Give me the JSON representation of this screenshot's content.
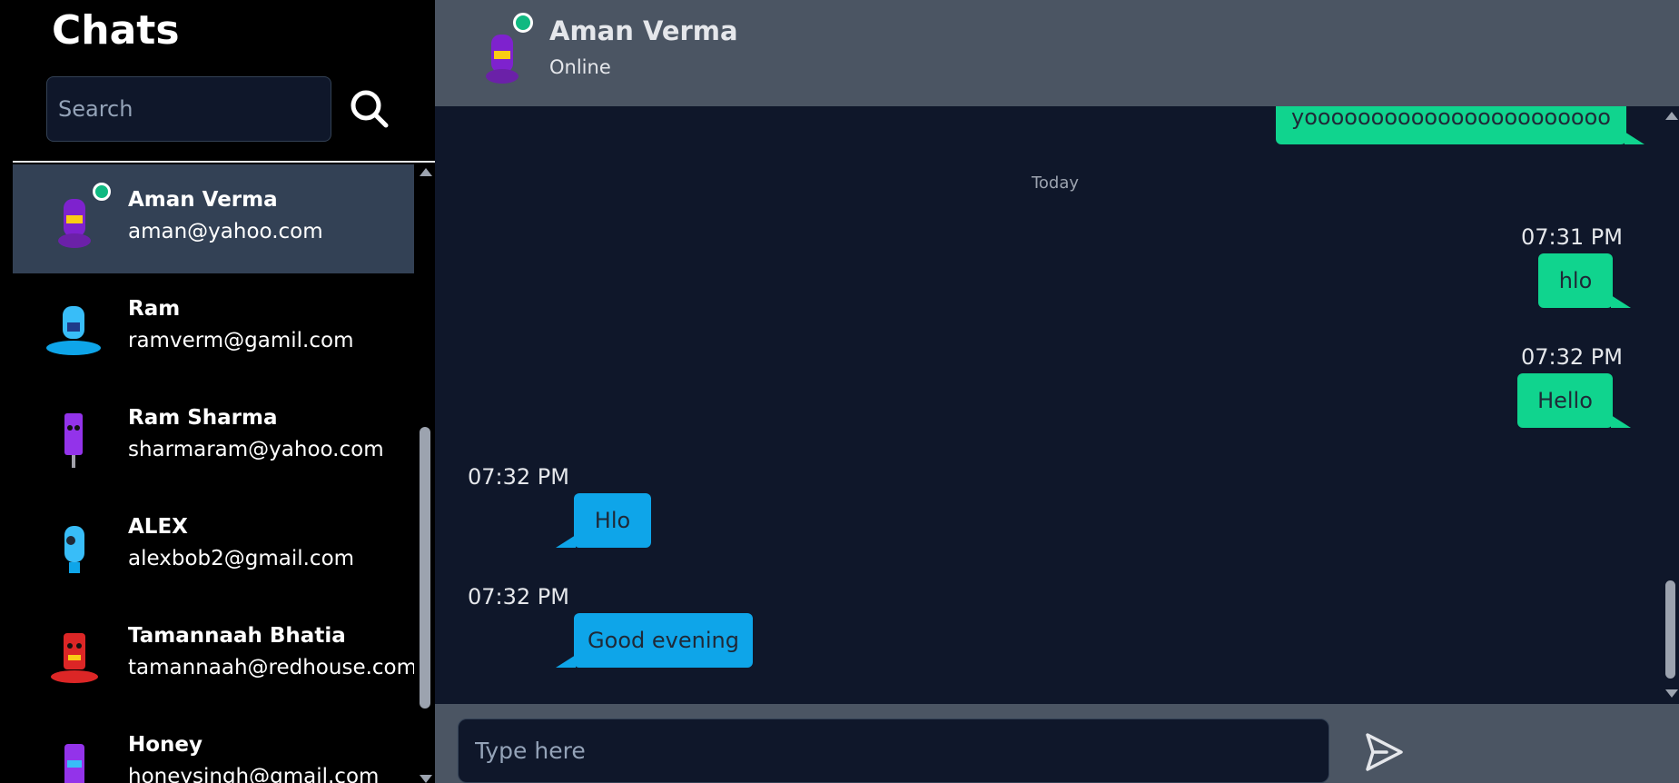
{
  "sidebar": {
    "title": "Chats",
    "search_placeholder": "Search",
    "contacts": [
      {
        "name": "Aman Verma",
        "email": "aman@yahoo.com",
        "online": true,
        "active": true,
        "avatar_color": "#7e22ce"
      },
      {
        "name": "Ram",
        "email": "ramverm@gamil.com",
        "online": false,
        "active": false,
        "avatar_color": "#38bdf8"
      },
      {
        "name": "Ram Sharma",
        "email": "sharmaram@yahoo.com",
        "online": false,
        "active": false,
        "avatar_color": "#9333ea"
      },
      {
        "name": "ALEX",
        "email": "alexbob2@gmail.com",
        "online": false,
        "active": false,
        "avatar_color": "#38bdf8"
      },
      {
        "name": "Tamannaah Bhatia",
        "email": "tamannaah@redhouse.com",
        "online": false,
        "active": false,
        "avatar_color": "#dc2626"
      },
      {
        "name": "Honey",
        "email": "honeysingh@gmail.com",
        "online": false,
        "active": false,
        "avatar_color": "#9333ea"
      }
    ]
  },
  "chat": {
    "title": "Aman Verma",
    "status": "Online",
    "date_separator": "Today",
    "messages": [
      {
        "direction": "sent",
        "text": "yooooooooooooooooooooooo",
        "time": ""
      },
      {
        "direction": "sent",
        "text": "hlo",
        "time": "07:31 PM"
      },
      {
        "direction": "sent",
        "text": "Hello",
        "time": "07:32 PM"
      },
      {
        "direction": "received",
        "text": "Hlo",
        "time": "07:32 PM"
      },
      {
        "direction": "received",
        "text": "Good evening",
        "time": "07:32 PM"
      }
    ]
  },
  "composer": {
    "placeholder": "Type here"
  },
  "icons": {
    "search": "search-icon",
    "send": "send-icon",
    "avatar": "robot-avatar-icon"
  },
  "colors": {
    "sidebar_bg": "#000000",
    "header_bg": "#4b5563",
    "chat_bg": "#0f172a",
    "sent_bubble": "#10d48e",
    "received_bubble": "#0ea5e9",
    "online": "#10b981",
    "active_contact": "#334155"
  }
}
